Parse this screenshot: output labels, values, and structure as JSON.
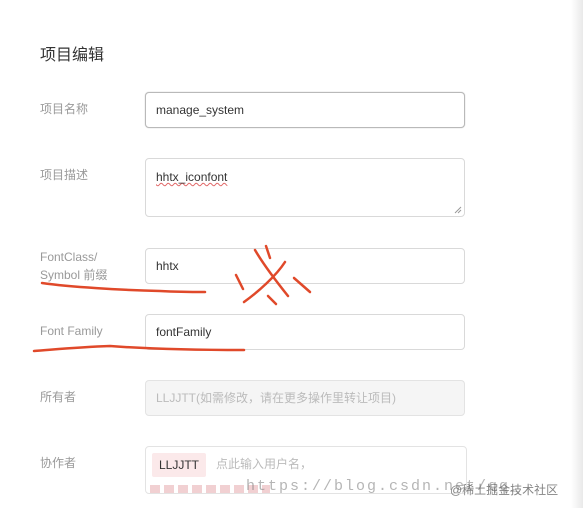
{
  "dialog": {
    "title": "项目编辑"
  },
  "form": {
    "project_name": {
      "label": "项目名称",
      "value": "manage_system"
    },
    "project_desc": {
      "label": "项目描述",
      "value": "hhtx_iconfont"
    },
    "font_class": {
      "label_line1": "FontClass/",
      "label_line2": "Symbol 前缀",
      "value": "hhtx"
    },
    "font_family": {
      "label": "Font Family",
      "value": "fontFamily"
    },
    "owner": {
      "label": "所有者",
      "value": "LLJJTT(如需修改，请在更多操作里转让项目)"
    },
    "collaborators": {
      "label": "协作者",
      "tag": "LLJJTT",
      "placeholder": "点此输入用户名，"
    }
  },
  "watermark": {
    "url": "https://blog.csdn.net/qq_",
    "site": "@稀土掘金技术社区"
  },
  "colors": {
    "annotation_red": "#e0492a",
    "tag_bg": "#fbe9ea"
  }
}
